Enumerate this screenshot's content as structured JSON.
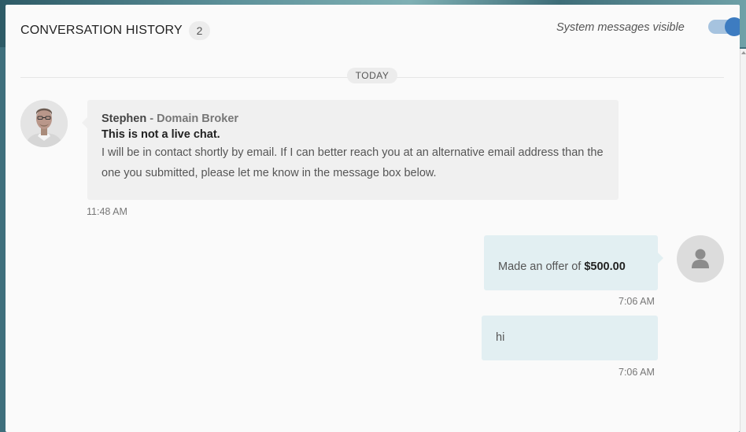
{
  "header": {
    "title": "CONVERSATION HISTORY",
    "message_count": "2",
    "system_toggle_label": "System messages visible",
    "system_toggle_on": true
  },
  "date_divider": "TODAY",
  "messages": [
    {
      "sender_name": "Stephen",
      "sender_separator": " - ",
      "sender_role": "Domain Broker",
      "notice": "This is not a live chat.",
      "body": "I will be in contact shortly by email. If I can better reach you at an alternative email address than the one you submitted, please let me know in the message box below.",
      "time": "11:48 AM"
    },
    {
      "offer_prefix": "Made an offer of ",
      "offer_amount": "$500.00",
      "time": "7:06 AM"
    },
    {
      "body": "hi",
      "time": "7:06 AM"
    }
  ],
  "icons": {
    "agent_avatar": "agent-photo",
    "user_avatar": "user-silhouette-icon"
  },
  "colors": {
    "toggle_track": "#a6c3df",
    "toggle_knob": "#3d7cc1",
    "user_bubble": "#e2eff2",
    "agent_bubble": "#f0f0f0"
  }
}
